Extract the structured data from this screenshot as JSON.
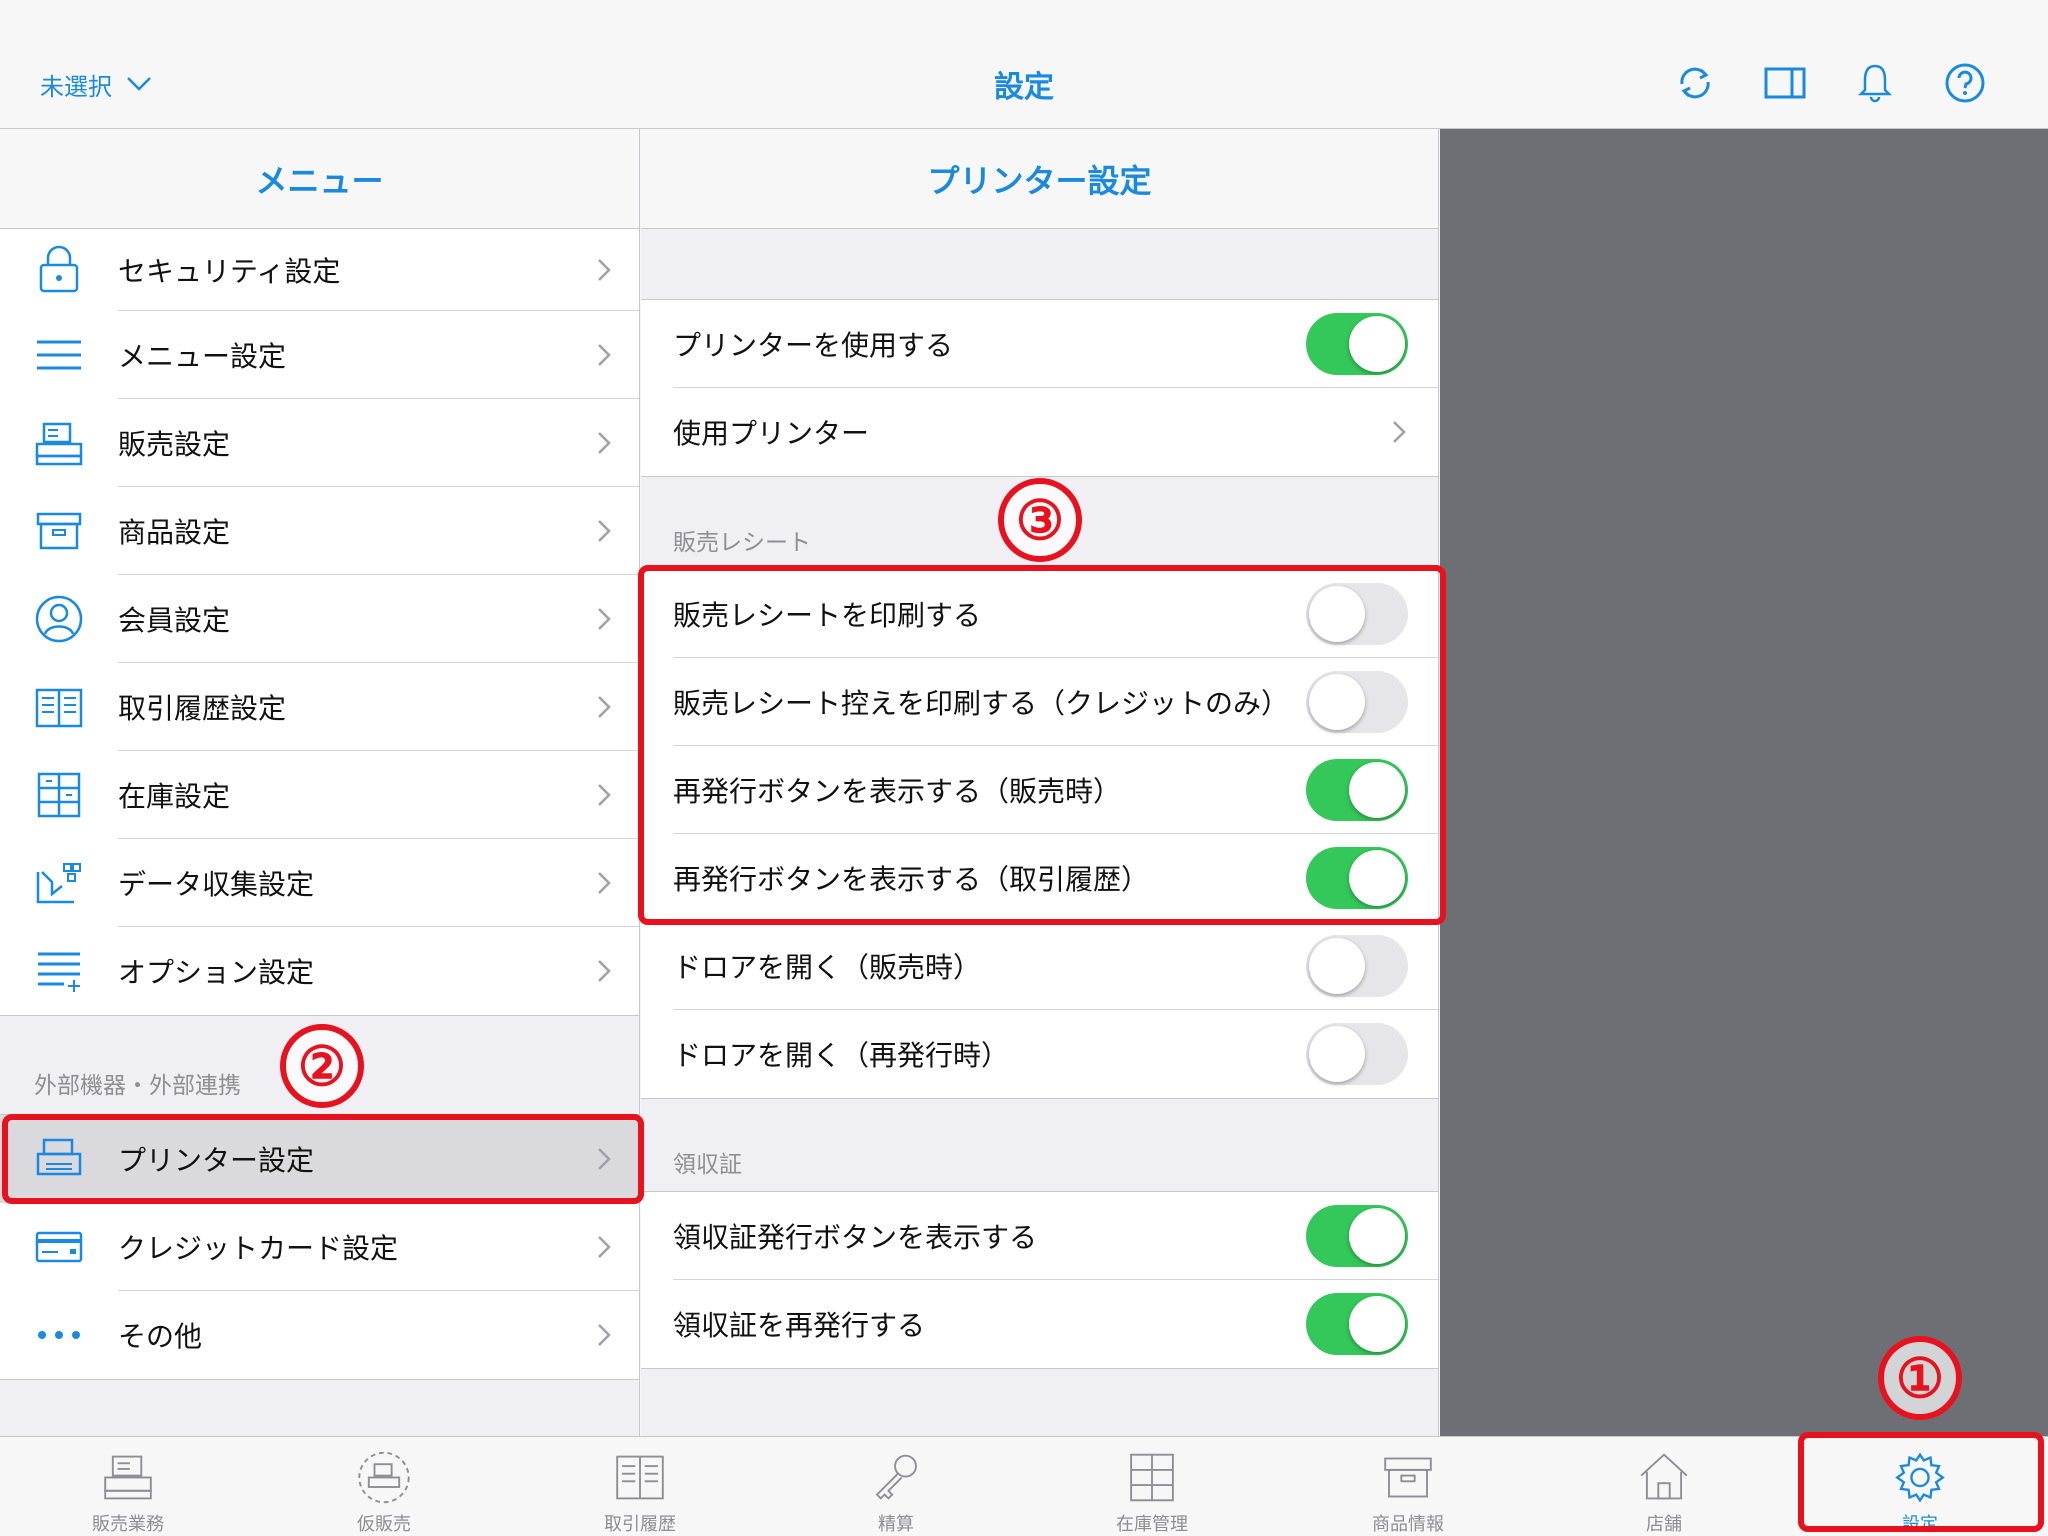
{
  "topbar": {
    "store_select": "未選択",
    "title": "設定"
  },
  "menu": {
    "header": "メニュー",
    "items": [
      {
        "label": "セキュリティ設定",
        "icon": "lock-icon"
      },
      {
        "label": "メニュー設定",
        "icon": "menu-lines-icon"
      },
      {
        "label": "販売設定",
        "icon": "register-icon"
      },
      {
        "label": "商品設定",
        "icon": "box-icon"
      },
      {
        "label": "会員設定",
        "icon": "person-icon"
      },
      {
        "label": "取引履歴設定",
        "icon": "book-icon"
      },
      {
        "label": "在庫設定",
        "icon": "cabinet-icon"
      },
      {
        "label": "データ収集設定",
        "icon": "data-icon"
      },
      {
        "label": "オプション設定",
        "icon": "options-icon"
      }
    ],
    "section_external": "外部機器・外部連携",
    "external_items": [
      {
        "label": "プリンター設定",
        "icon": "printer-icon",
        "selected": true
      },
      {
        "label": "クレジットカード設定",
        "icon": "credit-card-icon"
      },
      {
        "label": "その他",
        "icon": "more-dots-icon"
      }
    ]
  },
  "detail": {
    "header": "プリンター設定",
    "group1": [
      {
        "label": "プリンターを使用する",
        "type": "toggle",
        "on": true
      },
      {
        "label": "使用プリンター",
        "type": "chevron"
      }
    ],
    "section_sales_receipt": "販売レシート",
    "group2": [
      {
        "label": "販売レシートを印刷する",
        "on": false
      },
      {
        "label": "販売レシート控えを印刷する（クレジットのみ）",
        "on": false
      },
      {
        "label": "再発行ボタンを表示する（販売時）",
        "on": true
      },
      {
        "label": "再発行ボタンを表示する（取引履歴）",
        "on": true
      },
      {
        "label": "ドロアを開く（販売時）",
        "on": false
      },
      {
        "label": "ドロアを開く（再発行時）",
        "on": false
      }
    ],
    "section_receipt": "領収証",
    "group3": [
      {
        "label": "領収証発行ボタンを表示する",
        "on": true
      },
      {
        "label": "領収証を再発行する",
        "on": true
      }
    ]
  },
  "tabbar": {
    "tabs": [
      {
        "label": "販売業務",
        "icon": "register-icon"
      },
      {
        "label": "仮販売",
        "icon": "temp-sale-icon"
      },
      {
        "label": "取引履歴",
        "icon": "history-icon"
      },
      {
        "label": "精算",
        "icon": "key-icon"
      },
      {
        "label": "在庫管理",
        "icon": "cabinet-icon"
      },
      {
        "label": "商品情報",
        "icon": "box-icon"
      },
      {
        "label": "店舗",
        "icon": "store-icon"
      },
      {
        "label": "設定",
        "icon": "gear-icon",
        "active": true
      }
    ]
  },
  "callouts": [
    "①",
    "②",
    "③"
  ],
  "colors": {
    "accent": "#1a8ae0",
    "toggle_on": "#34c759",
    "highlight": "#e8121e",
    "side_pane": "#6d6f75"
  }
}
